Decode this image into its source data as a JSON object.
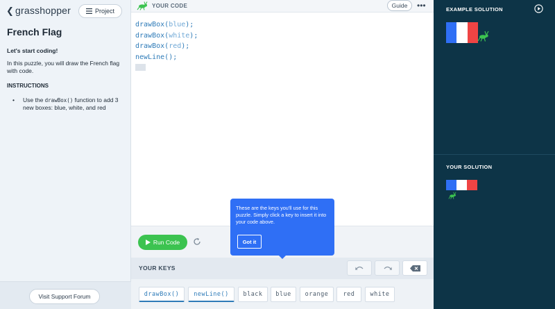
{
  "brand": {
    "logo_text": "grasshopper"
  },
  "left": {
    "project_label": "Project",
    "title": "French Flag",
    "subtitle": "Let's start coding!",
    "description": "In this puzzle, you will draw the French flag with code.",
    "instructions_heading": "INSTRUCTIONS",
    "instruction_pre": "Use the ",
    "instruction_code": "drawBox()",
    "instruction_post": " function to add 3 new boxes: blue, white, and red",
    "support_label": "Visit Support Forum"
  },
  "editor": {
    "header_label": "YOUR CODE",
    "guide_label": "Guide",
    "more_label": "•••",
    "lines": [
      {
        "fn": "drawBox",
        "open": "(",
        "arg": "blue",
        "close": ");"
      },
      {
        "fn": "drawBox",
        "open": "(",
        "arg": "white",
        "close": ");"
      },
      {
        "fn": "drawBox",
        "open": "(",
        "arg": "red",
        "close": ");"
      },
      {
        "fn": "newLine",
        "open": "(",
        "arg": "",
        "close": ");"
      }
    ],
    "run_label": "Run Code"
  },
  "tooltip": {
    "text": "These are the keys you'll use for this puzzle. Simply click a key to insert it into your code above.",
    "button_label": "Got it"
  },
  "keys": {
    "heading": "YOUR KEYS",
    "items": [
      "drawBox()",
      "newLine()",
      "black",
      "blue",
      "orange",
      "red",
      "white"
    ]
  },
  "right": {
    "example_heading": "EXAMPLE SOLUTION",
    "your_heading": "YOUR SOLUTION"
  },
  "colors": {
    "flag_blue": "#2f6ff5",
    "flag_white": "#ffffff",
    "flag_red": "#ef4444",
    "grasshopper_green": "#3cc350",
    "panel_dark": "#0d3447",
    "tooltip_blue": "#2f6ff5"
  }
}
